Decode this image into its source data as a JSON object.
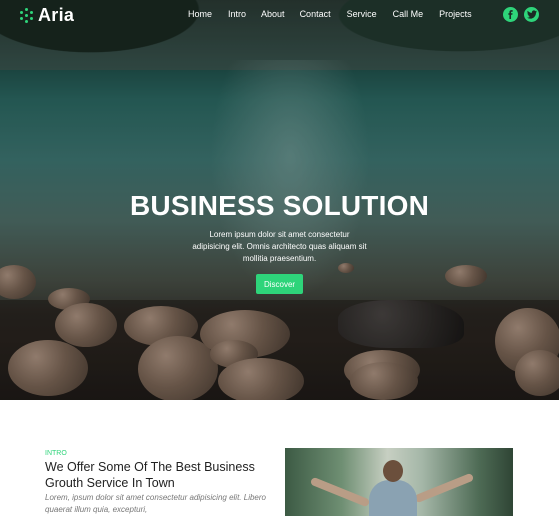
{
  "brand": {
    "name": "Aria",
    "accent_color": "#2ed47a"
  },
  "nav": {
    "items": [
      {
        "label": "Home"
      },
      {
        "label": "Intro"
      },
      {
        "label": "About"
      },
      {
        "label": "Contact"
      },
      {
        "label": "Service"
      },
      {
        "label": "Call Me"
      },
      {
        "label": "Projects"
      }
    ],
    "social": [
      {
        "icon": "facebook-icon"
      },
      {
        "icon": "twitter-icon"
      }
    ]
  },
  "hero": {
    "title": "BUSINESS SOLUTION",
    "text": "Lorem ipsum dolor sit amet consectetur adipisicing elit. Omnis architecto quas aliquam sit mollitia praesentium.",
    "button_label": "Discover"
  },
  "intro": {
    "label": "INTRO",
    "title": "We Offer Some Of The Best Business Grouth Service In Town",
    "text": "Lorem, ipsum dolor sit amet consectetur adipisicing elit. Libero quaerat illum quia, excepturi,"
  }
}
